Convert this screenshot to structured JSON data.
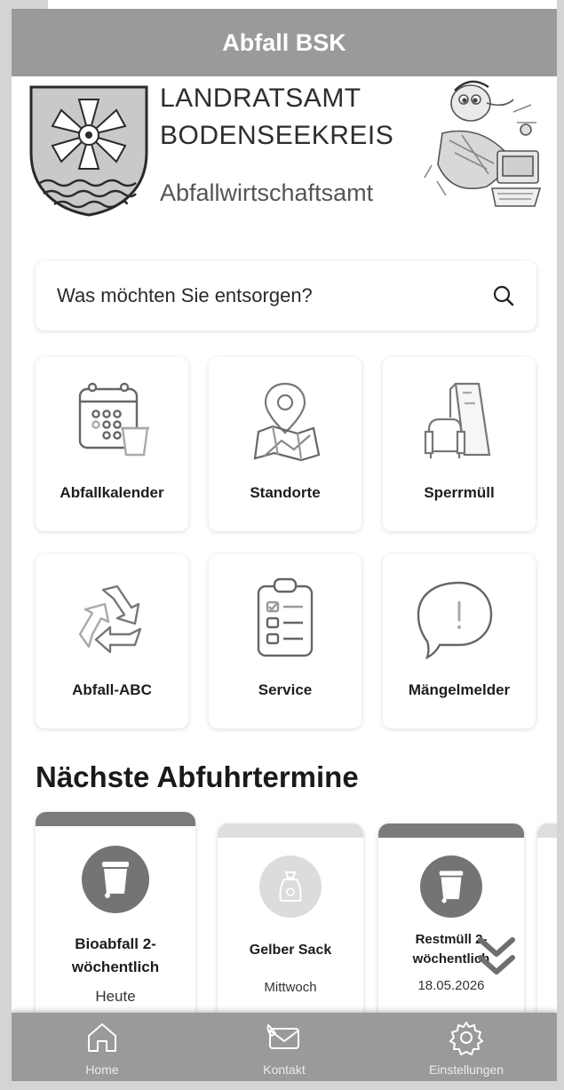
{
  "header": {
    "title": "Abfall BSK"
  },
  "banner": {
    "org_line1": "LANDRATSAMT",
    "org_line2": "BODENSEEKREIS",
    "org_line3": "Abfallwirtschaftsamt"
  },
  "search": {
    "placeholder": "Was möchten Sie entsorgen?",
    "icon": "search-icon"
  },
  "tiles": [
    {
      "label": "Abfallkalender",
      "icon": "calendar-bin-icon"
    },
    {
      "label": "Standorte",
      "icon": "map-pin-icon"
    },
    {
      "label": "Sperrmüll",
      "icon": "bulky-waste-icon"
    },
    {
      "label": "Abfall-ABC",
      "icon": "recycle-icon"
    },
    {
      "label": "Service",
      "icon": "clipboard-checklist-icon"
    },
    {
      "label": "Mängelmelder",
      "icon": "alert-speech-bubble-icon"
    }
  ],
  "pickups": {
    "title": "Nächste Abfuhrtermine",
    "items": [
      {
        "name": "Bioabfall 2-wöchentlich",
        "name_line1": "Bioabfall 2-",
        "name_line2": "wöchentlich",
        "when": "Heute",
        "icon": "bin-icon"
      },
      {
        "name": "Gelber Sack",
        "when": "Mittwoch",
        "icon": "recycling-bag-icon"
      },
      {
        "name": "Restmüll 2-wöchentlich",
        "name_line1": "Restmüll 2-",
        "name_line2": "wöchentlich",
        "when": "18.05.2026",
        "icon": "bin-icon"
      }
    ]
  },
  "tabbar": {
    "items": [
      {
        "label": "Home",
        "icon": "home-icon"
      },
      {
        "label": "Kontakt",
        "icon": "contact-phone-mail-icon"
      },
      {
        "label": "Einstellungen",
        "icon": "gear-icon"
      }
    ]
  },
  "colors": {
    "header_bg": "#9a9a9a",
    "card_bar_dark": "#7b7b7b",
    "card_bar_light": "#dedede",
    "bin_circle": "#747474",
    "bag_circle": "#dcdcdc"
  }
}
